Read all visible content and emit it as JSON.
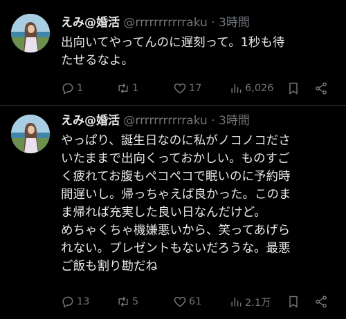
{
  "tweets": [
    {
      "name": "えみ@婚活",
      "handle": "@rrrrrrrrrrraku",
      "separator": "·",
      "time": "3時間",
      "text": "出向いてやってんのに遅刻って。1秒も待\nたせるなよ。",
      "replies": "1",
      "retweets": "1",
      "likes": "17",
      "views": "6,026"
    },
    {
      "name": "えみ@婚活",
      "handle": "@rrrrrrrrrrraku",
      "separator": "·",
      "time": "3時間",
      "text": "やっぱり、誕生日なのに私がノコノコださ\nいたままで出向くっておかしい。ものすご\nく疲れてお腹もペコペコで眠いのに予約時\n間遅いし。帰っちゃえば良かった。このま\nま帰れば充実した良い日なんだけど。\nめちゃくちゃ機嫌悪いから、笑ってあげら\nれない。プレゼントもないだろうな。最悪\nご飯も割り勘だね",
      "replies": "13",
      "retweets": "5",
      "likes": "61",
      "views": "2.1万"
    }
  ],
  "icons": {
    "reply": "reply-icon",
    "retweet": "retweet-icon",
    "like": "heart-icon",
    "views": "views-icon",
    "bookmark": "bookmark-icon",
    "share": "share-icon"
  },
  "colors": {
    "background": "#000000",
    "text": "#e7e9ea",
    "secondary": "#71767b",
    "divider": "#2f3336"
  }
}
